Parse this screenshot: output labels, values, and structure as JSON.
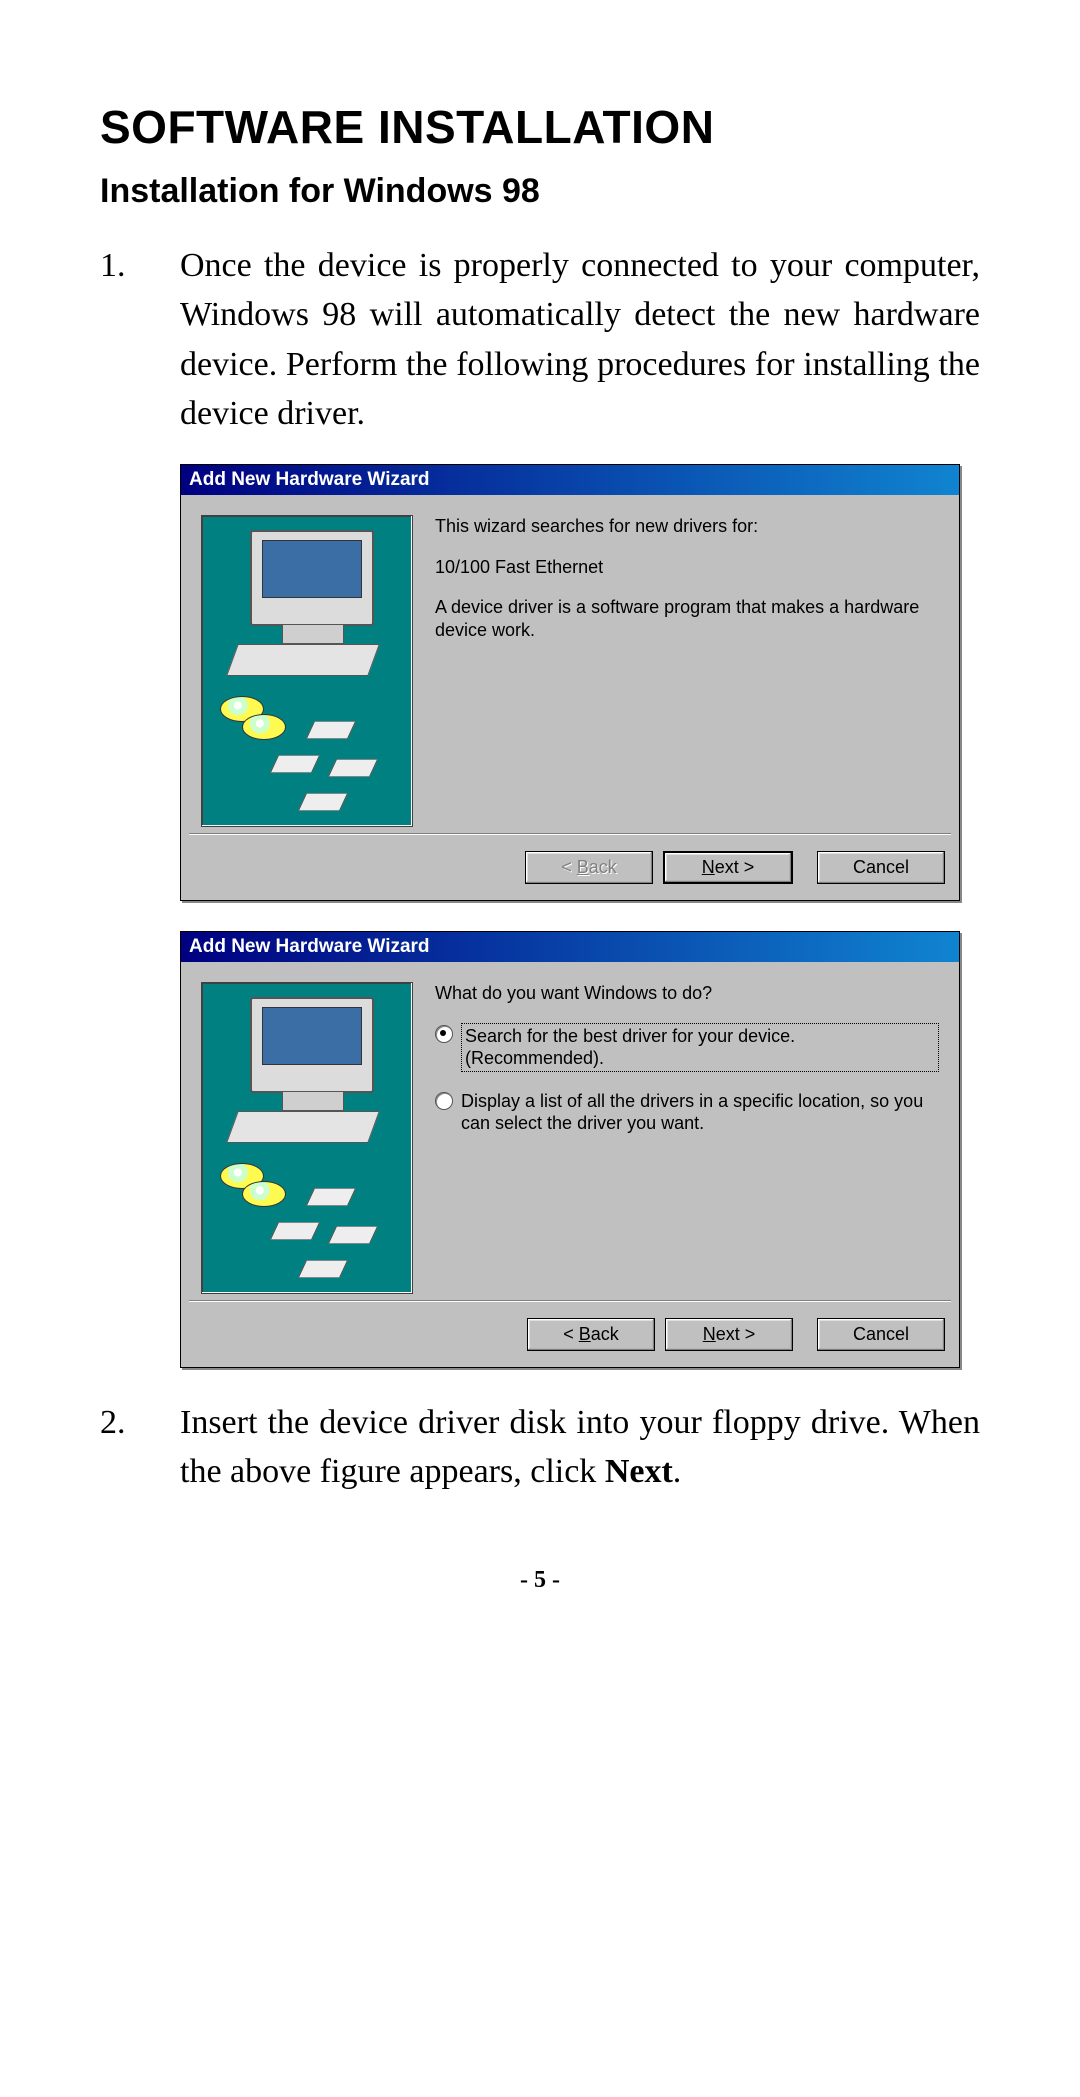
{
  "doc": {
    "title": "SOFTWARE INSTALLATION",
    "subtitle": "Installation for Windows 98",
    "page_number_display": "- 5 -"
  },
  "steps": {
    "s1_num": "1.",
    "s1_text": "Once the device is properly connected to your computer, Windows 98 will automatically detect the new hardware device. Perform the following procedures for installing the device driver.",
    "s2_num": "2.",
    "s2_text_a": "Insert the device driver disk into your floppy drive. When the above figure appears, click ",
    "s2_text_bold": "Next",
    "s2_text_b": "."
  },
  "wizard1": {
    "title": "Add New Hardware Wizard",
    "intro": "This wizard searches for new drivers for:",
    "device": "10/100 Fast Ethernet",
    "desc": "A device driver is a software program that makes a hardware device work.",
    "back_prefix": "< ",
    "back_char": "B",
    "back_rest": "ack",
    "next_char": "N",
    "next_rest": "ext >",
    "cancel": "Cancel"
  },
  "wizard2": {
    "title": "Add New Hardware Wizard",
    "question": "What do you want Windows to do?",
    "opt1": "Search for the best driver for your device. (Recommended).",
    "opt2": "Display a list of all the drivers in a specific location, so you can select the driver you want.",
    "back_prefix": "< ",
    "back_char": "B",
    "back_rest": "ack",
    "next_char": "N",
    "next_rest": "ext >",
    "cancel": "Cancel"
  }
}
